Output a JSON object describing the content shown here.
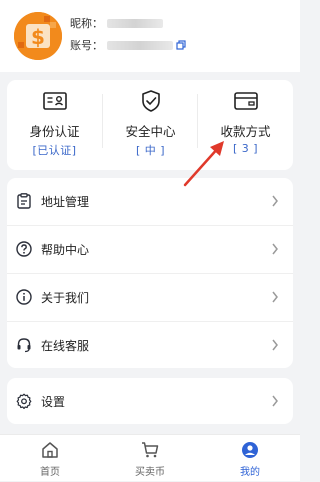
{
  "account": {
    "nickname_label": "昵称：",
    "account_label": "账号：",
    "avatar_icon": "dollar-coin-avatar",
    "avatar_color": "#f28a1c"
  },
  "stats": [
    {
      "label": "身份认证",
      "status": "[已认证]",
      "icon": "id-card-icon"
    },
    {
      "label": "安全中心",
      "status": "[ 中 ]",
      "icon": "shield-check-icon"
    },
    {
      "label": "收款方式",
      "status": "[ 3 ]",
      "icon": "wallet-card-icon"
    }
  ],
  "menu": [
    {
      "label": "地址管理",
      "icon": "clipboard-icon"
    },
    {
      "label": "帮助中心",
      "icon": "question-circle-icon"
    },
    {
      "label": "关于我们",
      "icon": "info-circle-icon"
    },
    {
      "label": "在线客服",
      "icon": "headset-icon"
    }
  ],
  "settings": {
    "label": "设置",
    "icon": "gear-icon"
  },
  "tabbar": [
    {
      "label": "首页",
      "icon": "home-icon",
      "active": false
    },
    {
      "label": "买卖币",
      "icon": "cart-icon",
      "active": false
    },
    {
      "label": "我的",
      "icon": "user-circle-icon",
      "active": true
    }
  ],
  "colors": {
    "accent": "#2f63d6",
    "background": "#f2f3f5",
    "annotation": "#e0392b"
  }
}
